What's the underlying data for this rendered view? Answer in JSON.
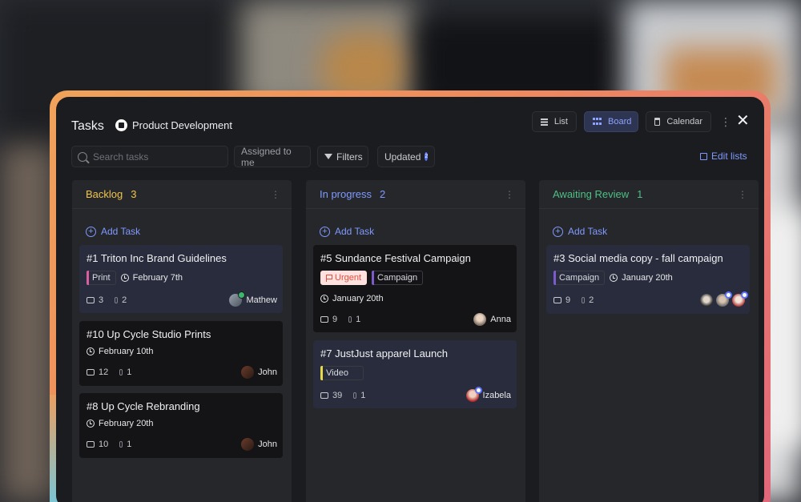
{
  "header": {
    "title": "Tasks",
    "project": "Product Development",
    "views": [
      {
        "label": "List",
        "active": false
      },
      {
        "label": "Board",
        "active": true
      },
      {
        "label": "Calendar",
        "active": false
      }
    ],
    "more_icon": "vertical-dots-icon",
    "close_icon": "close-icon"
  },
  "toolbar": {
    "search_placeholder": "Search tasks",
    "assigned_label": "Assigned to me",
    "filters_label": "Filters",
    "updated_label": "Updated",
    "updated_badge": "2",
    "edit_lists_label": "Edit lists"
  },
  "colors": {
    "accent": "#7f9aff",
    "backlog": "#f1c44e",
    "in_progress": "#7f9aff",
    "awaiting_review": "#4fbf86"
  },
  "columns": [
    {
      "title": "Backlog",
      "count": "3",
      "add_task": "Add Task",
      "cards": [
        {
          "title": "#1  Triton Inc Brand Guidelines",
          "tag": "Print",
          "tag_color": "#d95fa0",
          "date": "February 7th",
          "comments": "3",
          "attachments": "2",
          "assignee": "Mathew"
        },
        {
          "title": "#10  Up Cycle Studio Prints",
          "date": "February 10th",
          "comments": "12",
          "attachments": "1",
          "assignee": "John"
        },
        {
          "title": "#8  Up Cycle Rebranding",
          "date": "February 20th",
          "comments": "10",
          "attachments": "1",
          "assignee": "John"
        }
      ]
    },
    {
      "title": "In progress",
      "count": "2",
      "add_task": "Add Task",
      "cards": [
        {
          "title": "#5  Sundance Festival Campaign",
          "urgent": "Urgent",
          "tag": "Campaign",
          "tag_color": "#7b5cc9",
          "date": "January 20th",
          "comments": "9",
          "attachments": "1",
          "assignee": "Anna"
        },
        {
          "title": "#7  JustJust apparel Launch",
          "tag": "Video",
          "tag_color": "#e8d94a",
          "comments": "39",
          "attachments": "1",
          "assignee": "Izabela"
        }
      ]
    },
    {
      "title": "Awaiting Review",
      "count": "1",
      "add_task": "Add Task",
      "cards": [
        {
          "title": "#3  Social media copy - fall campaign",
          "tag": "Campaign",
          "tag_color": "#7b5cc9",
          "date": "January 20th",
          "comments": "9",
          "attachments": "2"
        }
      ]
    }
  ]
}
